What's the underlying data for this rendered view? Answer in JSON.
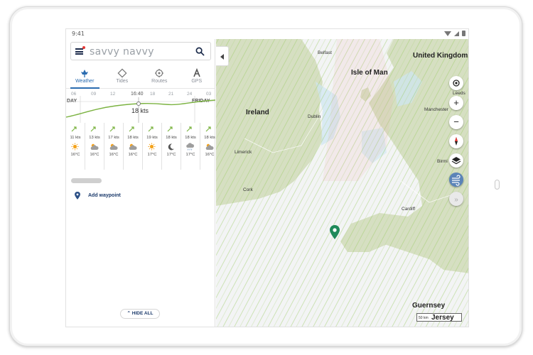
{
  "status": {
    "time": "9:41"
  },
  "search": {
    "placeholder": "savvy navvy"
  },
  "tabs": [
    {
      "label": "Weather",
      "icon": "weather-tab-icon",
      "active": true
    },
    {
      "label": "Tides",
      "icon": "tides-tab-icon",
      "active": false
    },
    {
      "label": "Routes",
      "icon": "routes-tab-icon",
      "active": false
    },
    {
      "label": "GPS",
      "icon": "gps-tab-icon",
      "active": false
    }
  ],
  "timeline": {
    "hours": [
      "06",
      "09",
      "12",
      "16:40",
      "18",
      "21",
      "24",
      "03"
    ],
    "day_prev": "DAY",
    "day_next": "FRIDAY",
    "current_wind": "18 kts",
    "columns": [
      {
        "wind": "11 kts",
        "weather": "sun-icon",
        "temp": "16°C"
      },
      {
        "wind": "13 kts",
        "weather": "partly-cloudy-icon",
        "temp": "16°C"
      },
      {
        "wind": "17 kts",
        "weather": "partly-cloudy-icon",
        "temp": "16°C"
      },
      {
        "wind": "18 kts",
        "weather": "partly-cloudy-icon",
        "temp": "16°C"
      },
      {
        "wind": "19 kts",
        "weather": "sun-icon",
        "temp": "17°C"
      },
      {
        "wind": "18 kts",
        "weather": "moon-icon",
        "temp": "17°C"
      },
      {
        "wind": "18 kts",
        "weather": "rain-cloud-icon",
        "temp": "17°C"
      },
      {
        "wind": "18 kts",
        "weather": "partly-cloudy-icon",
        "temp": "16°C"
      }
    ]
  },
  "waypoint": {
    "label": "Add waypoint"
  },
  "hide_all": {
    "label": "HIDE ALL"
  },
  "map": {
    "places": {
      "uk": "United Kingdom",
      "isle_of_man": "Isle of Man",
      "ireland": "Ireland",
      "belfast": "Belfast",
      "dublin": "Dublin",
      "leeds": "Leeds",
      "manchester": "Manchester",
      "limerick": "Limerick",
      "cork": "Cork",
      "cardiff": "Cardiff",
      "birmingham": "Birmi",
      "guernsey": "Guernsey",
      "jersey": "Jersey"
    },
    "scale_label": "50 km",
    "colors": {
      "land": "#d9e2c7",
      "sea": "#f5f6f7",
      "accent": "#2b6cb0",
      "marker": "#1f8a5a"
    }
  }
}
